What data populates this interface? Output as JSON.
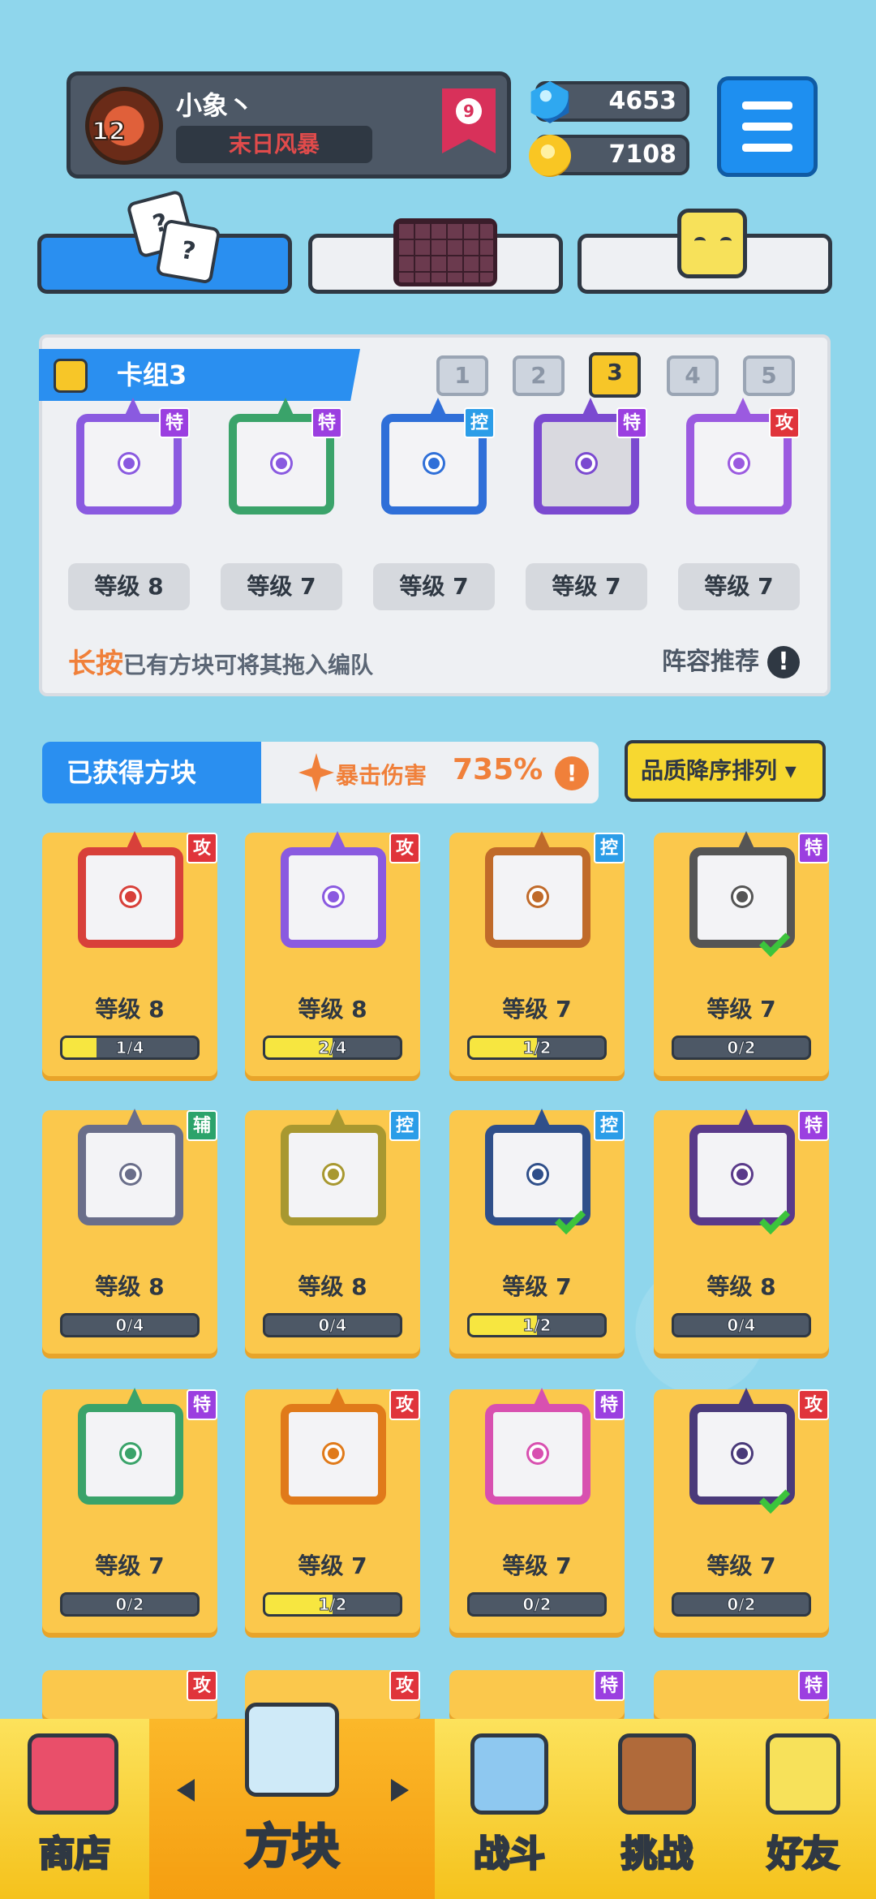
{
  "header": {
    "avatar_level": "12",
    "player_name": "小象丶",
    "player_title": "末日风暴",
    "rank": "9",
    "gems": "4653",
    "coins": "7108"
  },
  "deck": {
    "title": "卡组3",
    "slots": [
      "1",
      "2",
      "3",
      "4",
      "5"
    ],
    "active_slot": "3",
    "cards": [
      {
        "badge": "特",
        "level": "等级 8"
      },
      {
        "badge": "特",
        "level": "等级 7"
      },
      {
        "badge": "控",
        "level": "等级 7"
      },
      {
        "badge": "特",
        "level": "等级 7"
      },
      {
        "badge": "攻",
        "level": "等级 7"
      }
    ],
    "hint_highlight": "长按",
    "hint_text": "已有方块可将其拖入编队",
    "recommend": "阵容推荐",
    "recommend_icon": "!"
  },
  "owned": {
    "title": "已获得方块",
    "crit_label": "暴击伤害",
    "crit_value": "735%",
    "crit_icon": "!",
    "sort_label": "品质降序排列 ▾",
    "cards": [
      {
        "badge": "攻",
        "level": "等级 8",
        "progress": "1/4"
      },
      {
        "badge": "攻",
        "level": "等级 8",
        "progress": "2/4"
      },
      {
        "badge": "控",
        "level": "等级 7",
        "progress": "1/2"
      },
      {
        "badge": "特",
        "level": "等级 7",
        "progress": "0/2"
      },
      {
        "badge": "辅",
        "level": "等级 8",
        "progress": "0/4"
      },
      {
        "badge": "控",
        "level": "等级 8",
        "progress": "0/4"
      },
      {
        "badge": "控",
        "level": "等级 7",
        "progress": "1/2"
      },
      {
        "badge": "特",
        "level": "等级 8",
        "progress": "0/4"
      },
      {
        "badge": "特",
        "level": "等级 7",
        "progress": "0/2"
      },
      {
        "badge": "攻",
        "level": "等级 7",
        "progress": "1/2"
      },
      {
        "badge": "特",
        "level": "等级 7",
        "progress": "0/2"
      },
      {
        "badge": "攻",
        "level": "等级 7",
        "progress": "0/2"
      }
    ],
    "partial_badges": [
      "攻",
      "攻",
      "特",
      "特"
    ]
  },
  "nav": {
    "shop": "商店",
    "blocks": "方块",
    "battle": "战斗",
    "challenge": "挑战",
    "friends": "好友"
  },
  "colors": {
    "blue": "#2a8ff0",
    "yellow": "#fbc84c",
    "dark": "#2f3843"
  }
}
